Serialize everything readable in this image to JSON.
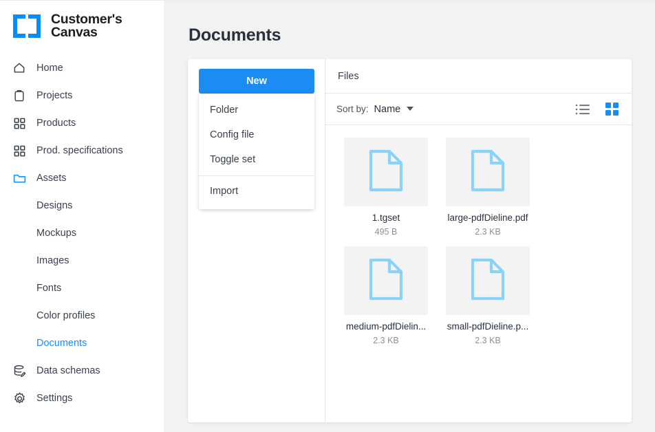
{
  "brand": {
    "name_line1": "Customer's",
    "name_line2": "Canvas",
    "logo_icon": "brackets-logo-icon",
    "accent_color": "#0a8bf5"
  },
  "sidebar": {
    "items": [
      {
        "label": "Home",
        "icon": "home-icon",
        "level": "top",
        "active": false
      },
      {
        "label": "Projects",
        "icon": "clipboard-icon",
        "level": "top",
        "active": false
      },
      {
        "label": "Products",
        "icon": "grid-squares-icon",
        "level": "top",
        "active": false
      },
      {
        "label": "Prod. specifications",
        "icon": "grid-squares-icon",
        "level": "top",
        "active": false
      },
      {
        "label": "Assets",
        "icon": "folder-icon",
        "level": "top",
        "active": true
      },
      {
        "label": "Designs",
        "icon": "",
        "level": "sub",
        "active": false
      },
      {
        "label": "Mockups",
        "icon": "",
        "level": "sub",
        "active": false
      },
      {
        "label": "Images",
        "icon": "",
        "level": "sub",
        "active": false
      },
      {
        "label": "Fonts",
        "icon": "",
        "level": "sub",
        "active": false
      },
      {
        "label": "Color profiles",
        "icon": "",
        "level": "sub",
        "active": false
      },
      {
        "label": "Documents",
        "icon": "",
        "level": "sub",
        "active": true
      },
      {
        "label": "Data schemas",
        "icon": "database-edit-icon",
        "level": "top",
        "active": false
      },
      {
        "label": "Settings",
        "icon": "gear-icon",
        "level": "top",
        "active": false
      }
    ]
  },
  "page": {
    "title": "Documents"
  },
  "new_menu": {
    "button_label": "New",
    "items": [
      {
        "label": "Folder",
        "separator_before": false
      },
      {
        "label": "Config file",
        "separator_before": false
      },
      {
        "label": "Toggle set",
        "separator_before": false
      },
      {
        "label": "Import",
        "separator_before": true
      }
    ]
  },
  "files_panel": {
    "header": "Files",
    "sort_by_label": "Sort by:",
    "sort_by_value": "Name",
    "sort_caret_icon": "chevron-down-icon",
    "view_list_icon": "list-view-icon",
    "view_grid_icon": "grid-view-icon",
    "active_view": "grid",
    "files": [
      {
        "name": "1.tgset",
        "size": "495 B",
        "icon": "file-document-icon"
      },
      {
        "name": "large-pdfDieline.pdf",
        "size": "2.3 KB",
        "icon": "file-document-icon"
      },
      {
        "name": "medium-pdfDielin...",
        "size": "2.3 KB",
        "icon": "file-document-icon"
      },
      {
        "name": "small-pdfDieline.p...",
        "size": "2.3 KB",
        "icon": "file-document-icon"
      }
    ]
  },
  "colors": {
    "accent_blue": "#1b8cf3",
    "file_icon_blue": "#8ad2f7",
    "thumb_bg": "#f3f3f4",
    "page_bg": "#f2f2f2",
    "text_dark": "#26303e",
    "text_muted": "#8a909b"
  }
}
